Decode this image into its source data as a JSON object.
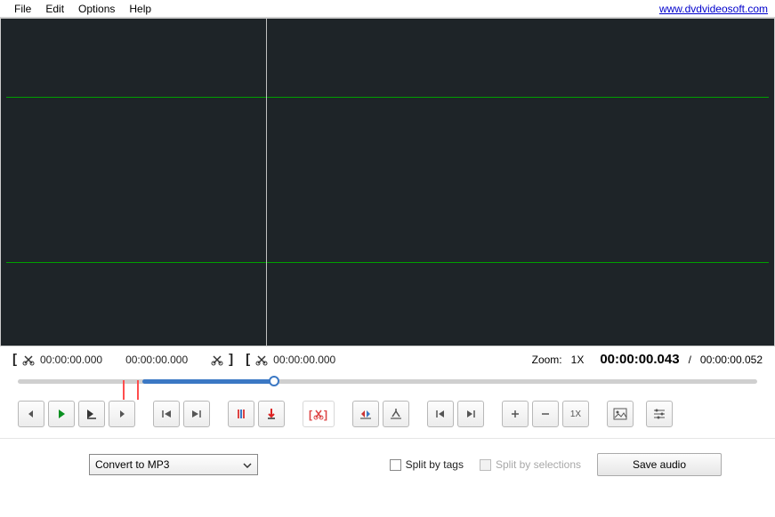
{
  "menu": {
    "file": "File",
    "edit": "Edit",
    "options": "Options",
    "help": "Help",
    "link": "www.dvdvideosoft.com"
  },
  "tc": {
    "sel_start": "00:00:00.000",
    "sel_dur": "00:00:00.000",
    "sel_end": "00:00:00.000"
  },
  "zoom": {
    "label": "Zoom:",
    "value": "1X"
  },
  "position": "00:00:00.043",
  "sep": "/",
  "total": "00:00:00.052",
  "combo": "Convert to MP3",
  "chk1": "Split by tags",
  "chk2": "Split by selections",
  "save": "Save audio",
  "zoom1x": "1X"
}
